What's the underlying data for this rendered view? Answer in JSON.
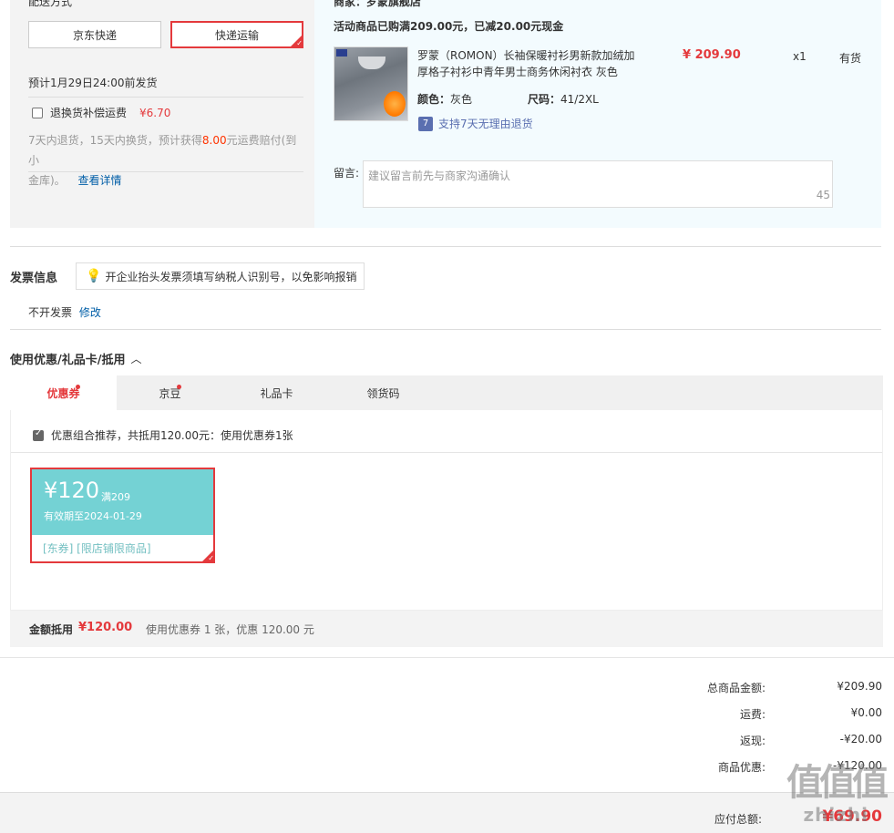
{
  "shipping": {
    "section_label": "配送方式",
    "options": [
      {
        "label": "京东快递"
      },
      {
        "label": "快递运输"
      }
    ],
    "delivery_note": "预计1月29日24:00前发货",
    "insurance_label": "退换货补偿运费",
    "insurance_price": "¥6.70",
    "insurance_desc_1": "7天内退货，15天内换货，预计获得",
    "insurance_amount": "8.00",
    "insurance_desc_2": "元运费赔付(到小",
    "insurance_desc_3": "金库)。",
    "details_link": "查看详情"
  },
  "store": {
    "seller_line": "商家：罗蒙旗舰店",
    "promo_line": "活动商品已购满209.00元，已减20.00元现金",
    "product": {
      "title_line1": "罗蒙（ROMON）长袖保暖衬衫男新款加绒加",
      "title_line2": "厚格子衬衫中青年男士商务休闲衬衣 灰色",
      "price": "¥ 209.90",
      "quantity": "x1",
      "stock": "有货",
      "color_label": "颜色：",
      "color_value": "灰色",
      "size_label": "尺码：",
      "size_value": "41/2XL",
      "return_badge": "7",
      "return_text": "支持7天无理由退货"
    },
    "note_label": "留言:",
    "note_placeholder": "建议留言前先与商家沟通确认",
    "note_counter": "45"
  },
  "invoice": {
    "title": "发票信息",
    "tip": "开企业抬头发票须填写纳税人识别号，以免影响报销",
    "status": "不开发票",
    "edit_link": "修改"
  },
  "discount": {
    "title": "使用优惠/礼品卡/抵用",
    "tabs": [
      {
        "label": "优惠券"
      },
      {
        "label": "京豆"
      },
      {
        "label": "礼品卡"
      },
      {
        "label": "领货码"
      }
    ],
    "combo_text": "优惠组合推荐，共抵用120.00元：使用优惠券1张",
    "coupon": {
      "amount": "¥120",
      "condition": "满209",
      "validity": "有效期至2024-01-29",
      "tags": "[东券] [限店铺限商品]"
    },
    "summary_label": "金额抵用",
    "summary_amount": "¥120.00",
    "summary_desc": "使用优惠券 1 张，优惠 120.00 元"
  },
  "totals": {
    "rows": [
      {
        "label": "总商品金额:",
        "value": "¥209.90"
      },
      {
        "label": "运费:",
        "value": "¥0.00"
      },
      {
        "label": "返现:",
        "value": "-¥20.00"
      },
      {
        "label": "商品优惠:",
        "value": "-¥120.00"
      }
    ],
    "payable_label": "应付总额:",
    "payable_value": "¥69.90"
  },
  "watermark": {
    "glyphs": "值值值",
    "site": "zhizhi"
  },
  "colors": {
    "accent": "#e4393c",
    "coupon": "#74d2d4",
    "link": "#005ea7"
  }
}
